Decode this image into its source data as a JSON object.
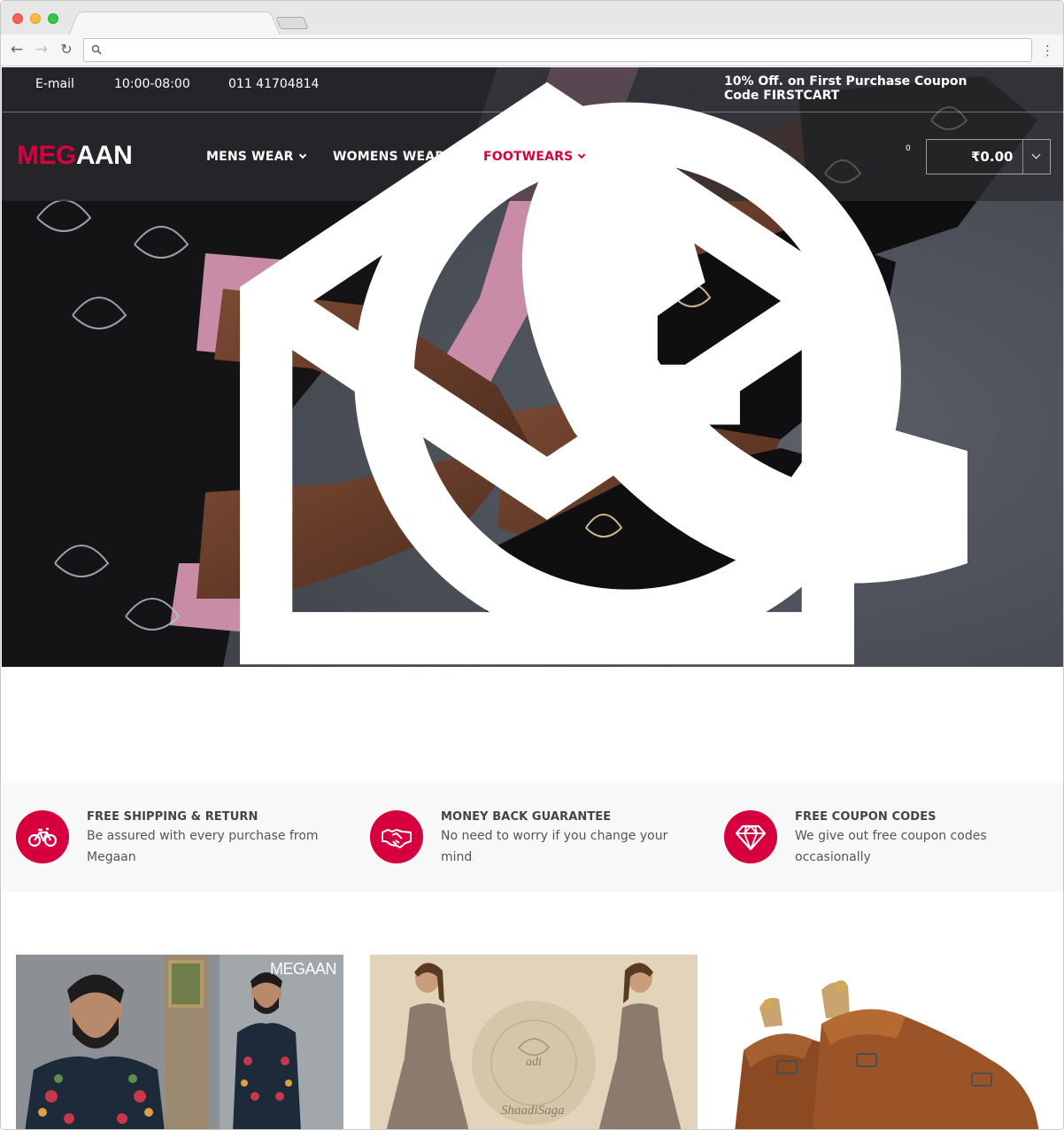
{
  "topbar": {
    "email_label": "E-mail",
    "hours": "10:00-08:00",
    "phone": "011 41704814",
    "promo": "10% Off. on First Purchase Coupon Code FIRSTCART"
  },
  "logo": {
    "part1": "MEG",
    "part2": "AAN"
  },
  "nav": [
    {
      "label": "MENS WEAR",
      "active": false
    },
    {
      "label": "WOMENS WEAR",
      "active": false
    },
    {
      "label": "FOOTWEARS",
      "active": true
    }
  ],
  "header_icons": {
    "wishlist_count": "0",
    "cart_total": "₹0.00"
  },
  "features": [
    {
      "title": "FREE SHIPPING & RETURN",
      "desc": "Be assured with every purchase from Megaan",
      "icon": "bicycle-icon"
    },
    {
      "title": "MONEY BACK GUARANTEE",
      "desc": "No need to worry if you change your mind",
      "icon": "handshake-icon"
    },
    {
      "title": "FREE COUPON CODES",
      "desc": "We give out free coupon codes occasionally",
      "icon": "diamond-icon"
    }
  ],
  "cards": [
    {
      "tag": "MEGAAN"
    },
    {
      "brand": "ShaadiSaga"
    },
    {}
  ],
  "colors": {
    "accent": "#d6003f",
    "header_overlay": "#2d2d30",
    "features_bg": "#f8f8f8"
  }
}
